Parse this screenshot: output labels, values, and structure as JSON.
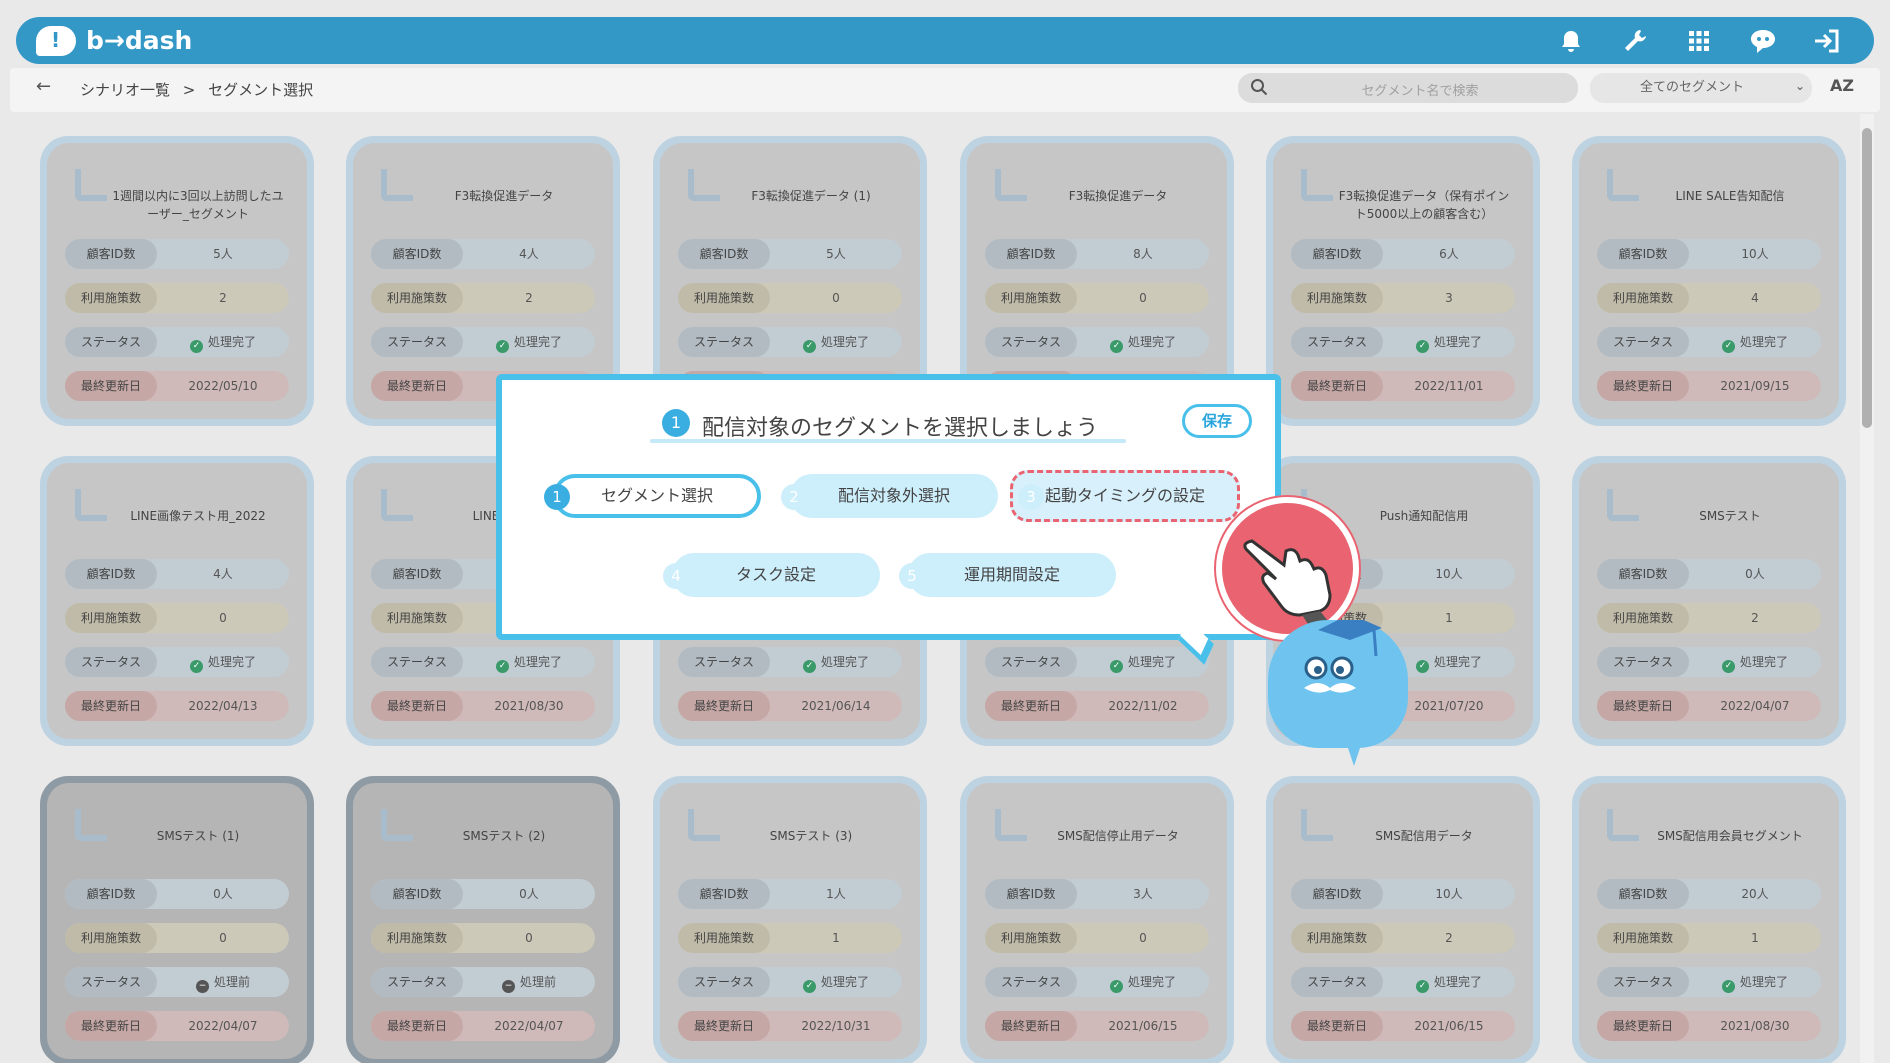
{
  "header": {
    "logo_text": "b→dash",
    "icons": [
      "bell-icon",
      "wrench-icon",
      "grid-icon",
      "chat-icon",
      "logout-icon"
    ]
  },
  "breadcrumb": {
    "root": "シナリオ一覧",
    "separator": ">",
    "current": "セグメント選択"
  },
  "search": {
    "placeholder": "セグメント名で検索"
  },
  "filter": {
    "selected": "全てのセグメント"
  },
  "sort_label": "AZ",
  "labels": {
    "ids": "顧客ID数",
    "uses": "利用施策数",
    "status": "ステータス",
    "updated": "最終更新日"
  },
  "cards": [
    {
      "title": "1週間以内に3回以上訪問したユーザー_セグメント",
      "ids": "5人",
      "uses": "2",
      "status": "処理完了",
      "updated": "2022/05/10"
    },
    {
      "title": "F3転換促進データ",
      "ids": "4人",
      "uses": "2",
      "status": "処理完了",
      "updated": ""
    },
    {
      "title": "F3転換促進データ (1)",
      "ids": "5人",
      "uses": "0",
      "status": "処理完了",
      "updated": ""
    },
    {
      "title": "F3転換促進データ",
      "ids": "8人",
      "uses": "0",
      "status": "処理完了",
      "updated": ""
    },
    {
      "title": "F3転換促進データ（保有ポイント5000以上の顧客含む）",
      "ids": "6人",
      "uses": "3",
      "status": "処理完了",
      "updated": "2022/11/01"
    },
    {
      "title": "LINE SALE告知配信",
      "ids": "10人",
      "uses": "4",
      "status": "処理完了",
      "updated": "2021/09/15"
    },
    {
      "title": "LINE画像テスト用_2022",
      "ids": "4人",
      "uses": "0",
      "status": "処理完了",
      "updated": "2022/04/13"
    },
    {
      "title": "LINE配信会",
      "ids": "",
      "uses": "",
      "status": "処理完了",
      "updated": "2021/08/30"
    },
    {
      "title": "",
      "ids": "",
      "uses": "",
      "status": "処理完了",
      "updated": "2021/06/14"
    },
    {
      "title": "",
      "ids": "",
      "uses": "",
      "status": "処理完了",
      "updated": "2022/11/02"
    },
    {
      "title": "Push通知配信用",
      "ids": "10人",
      "uses": "1",
      "status": "処理完了",
      "updated": "2021/07/20"
    },
    {
      "title": "SMSテスト",
      "ids": "0人",
      "uses": "2",
      "status": "処理完了",
      "updated": "2022/04/07"
    },
    {
      "title": "SMSテスト (1)",
      "ids": "0人",
      "uses": "0",
      "status": "処理前",
      "updated": "2022/04/07"
    },
    {
      "title": "SMSテスト (2)",
      "ids": "0人",
      "uses": "0",
      "status": "処理前",
      "updated": "2022/04/07"
    },
    {
      "title": "SMSテスト (3)",
      "ids": "1人",
      "uses": "1",
      "status": "処理完了",
      "updated": "2022/10/31"
    },
    {
      "title": "SMS配信停止用データ",
      "ids": "3人",
      "uses": "0",
      "status": "処理完了",
      "updated": "2021/06/15"
    },
    {
      "title": "SMS配信用データ",
      "ids": "10人",
      "uses": "2",
      "status": "処理完了",
      "updated": "2021/06/15"
    },
    {
      "title": "SMS配信用会員セグメント",
      "ids": "20人",
      "uses": "1",
      "status": "処理完了",
      "updated": "2021/08/30"
    }
  ],
  "modal": {
    "step_num": "1",
    "title": "配信対象のセグメントを選択しましょう",
    "save": "保存",
    "steps": [
      {
        "num": "1",
        "label": "セグメント選択"
      },
      {
        "num": "2",
        "label": "配信対象外選択"
      },
      {
        "num": "3",
        "label": "起動タイミングの設定"
      },
      {
        "num": "4",
        "label": "タスク設定"
      },
      {
        "num": "5",
        "label": "運用期間設定"
      }
    ]
  }
}
